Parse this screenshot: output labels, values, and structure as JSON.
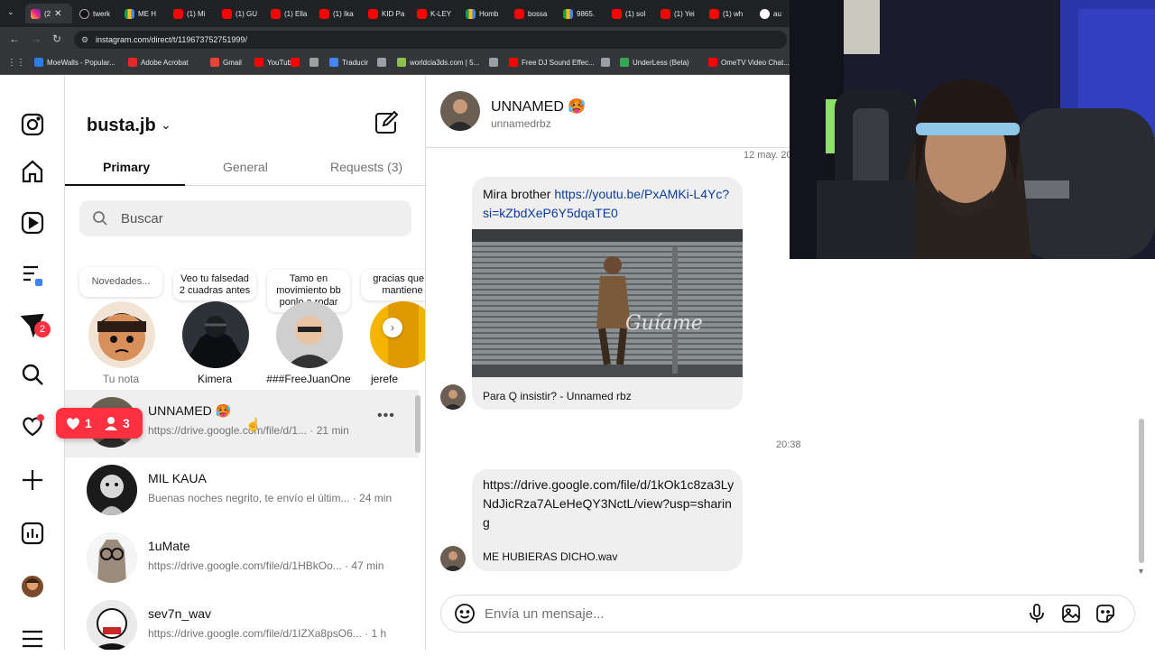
{
  "browser": {
    "tabs": [
      {
        "label": "(2",
        "type": "ig",
        "active": true
      },
      {
        "label": "twerk",
        "type": "tk"
      },
      {
        "label": "ME H",
        "type": "dr"
      },
      {
        "label": "(1) Mi",
        "type": "yt"
      },
      {
        "label": "(1) GU",
        "type": "yt"
      },
      {
        "label": "(1) Ella",
        "type": "yt"
      },
      {
        "label": "(1) Ika",
        "type": "yt"
      },
      {
        "label": "KID Pa",
        "type": "yt"
      },
      {
        "label": "K-LEY",
        "type": "yt"
      },
      {
        "label": "Homb",
        "type": "dr"
      },
      {
        "label": "bossa",
        "type": "yt"
      },
      {
        "label": "9865.",
        "type": "dr"
      },
      {
        "label": "(1) sol",
        "type": "yt"
      },
      {
        "label": "(1) Yei",
        "type": "yt"
      },
      {
        "label": "(1) wh",
        "type": "yt"
      },
      {
        "label": "au",
        "type": "gg"
      }
    ],
    "url": "instagram.com/direct/t/119673752751999/",
    "bookmarks": [
      {
        "label": "MoeWalls - Popular...",
        "color": "#2b7de9"
      },
      {
        "label": "Adobe Acrobat",
        "color": "#e22828"
      },
      {
        "label": "Gmail",
        "color": "#ea4335"
      },
      {
        "label": "YouTube",
        "color": "#ff0000"
      },
      {
        "label": "",
        "color": "#ff0000"
      },
      {
        "label": "",
        "color": "#9aa0a6"
      },
      {
        "label": "Traducir",
        "color": "#4285f4"
      },
      {
        "label": "",
        "color": "#9aa0a6"
      },
      {
        "label": "worldcia3ds.com | 5...",
        "color": "#8bc34a"
      },
      {
        "label": "",
        "color": "#9aa0a6"
      },
      {
        "label": "Free DJ Sound Effec...",
        "color": "#ff0000"
      },
      {
        "label": "",
        "color": "#9aa0a6"
      },
      {
        "label": "UnderLess (Beta)",
        "color": "#34a853"
      },
      {
        "label": "OmeTV Video Chat...",
        "color": "#ff0000"
      }
    ]
  },
  "rail": {
    "messages_badge": "2"
  },
  "list": {
    "username": "busta.jb",
    "tabs": [
      "Primary",
      "General",
      "Requests (3)"
    ],
    "search_placeholder": "Buscar",
    "notes": [
      {
        "note": "Novedades...",
        "name": "Tu nota"
      },
      {
        "note": "Veo tu falsedad 2 cuadras antes",
        "name": "Kimera"
      },
      {
        "note": "Tamo en movimiento bb ponlo a rodar",
        "name": "###FreeJuanOne"
      },
      {
        "note": "gracias que s mantiene",
        "name": "jerefe"
      }
    ],
    "conversations": [
      {
        "name": "UNNAMED 🥵",
        "preview": "https://drive.google.com/file/d/1... · 21 min"
      },
      {
        "name": "MIL KAUA",
        "preview": "Buenas noches negrito, te envío el últim... · 24 min"
      },
      {
        "name": "1uMate",
        "preview": "https://drive.google.com/file/d/1HBkOo... · 47 min"
      },
      {
        "name": "sev7n_wav",
        "preview": "https://drive.google.com/file/d/1IZXa8psO6... · 1 h"
      }
    ],
    "notif": {
      "likes": "1",
      "followers": "3"
    }
  },
  "chat": {
    "name": "UNNAMED 🥵",
    "handle": "unnamedrbz",
    "timestamp_top": "12 may. 20",
    "msg1_text": "Mira brother ",
    "msg1_link": "https://youtu.be/PxAMKi-L4Yc?si=kZbdXeP6Y5dqaTE0",
    "video_overlay": "Guíame",
    "msg1_caption": "Para Q insistir? - Unnamed rbz",
    "timestamp_mid": "20:38",
    "msg2_link": "https://drive.google.com/file/d/1kOk1c8za3LyNdJicRza7ALeHeQY3NctL/view?usp=sharing",
    "msg2_caption": "ME HUBIERAS DICHO.wav",
    "composer_placeholder": "Envía un mensaje..."
  },
  "colors": {
    "accent_red": "#ff3040",
    "link_blue": "#0c3d9c",
    "chrome_dark": "#202124",
    "chrome_mid": "#35363a"
  }
}
